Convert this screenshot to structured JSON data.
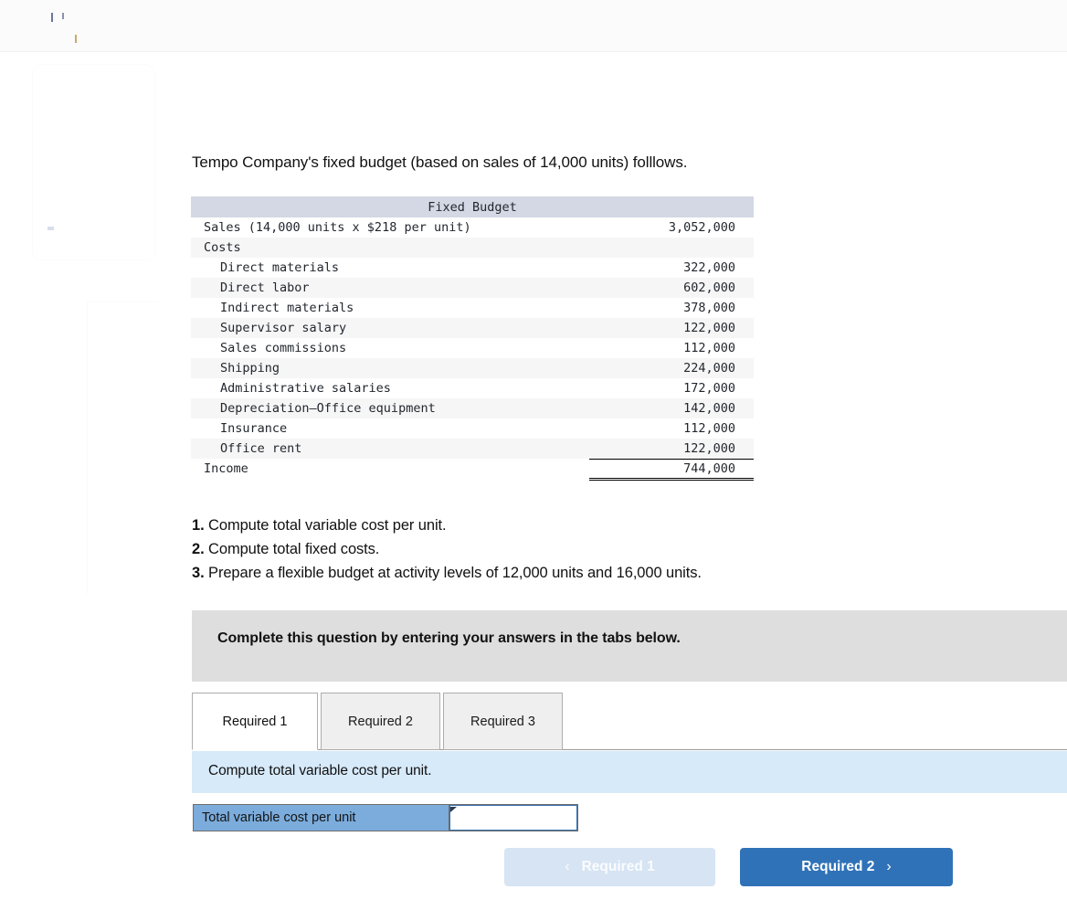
{
  "intro": "Tempo Company's fixed budget (based on sales of 14,000 units) folllows.",
  "budget_table": {
    "header": "Fixed Budget",
    "rows": [
      {
        "label": "Sales (14,000 units x $218 per unit)",
        "indent": 1,
        "amount": "3,052,000"
      },
      {
        "label": "Costs",
        "indent": 1,
        "amount": ""
      },
      {
        "label": "Direct materials",
        "indent": 2,
        "amount": "322,000"
      },
      {
        "label": "Direct labor",
        "indent": 2,
        "amount": "602,000"
      },
      {
        "label": "Indirect materials",
        "indent": 2,
        "amount": "378,000"
      },
      {
        "label": "Supervisor salary",
        "indent": 2,
        "amount": "122,000"
      },
      {
        "label": "Sales commissions",
        "indent": 2,
        "amount": "112,000"
      },
      {
        "label": "Shipping",
        "indent": 2,
        "amount": "224,000"
      },
      {
        "label": "Administrative salaries",
        "indent": 2,
        "amount": "172,000"
      },
      {
        "label": "Depreciation—Office equipment",
        "indent": 2,
        "amount": "142,000"
      },
      {
        "label": "Insurance",
        "indent": 2,
        "amount": "112,000"
      },
      {
        "label": "Office rent",
        "indent": 2,
        "amount": "122,000"
      },
      {
        "label": "Income",
        "indent": 1,
        "amount": "744,000"
      }
    ]
  },
  "requirements": [
    {
      "num": "1.",
      "text": "Compute total variable cost per unit."
    },
    {
      "num": "2.",
      "text": "Compute total fixed costs."
    },
    {
      "num": "3.",
      "text": "Prepare a flexible budget at activity levels of 12,000 units and 16,000 units."
    }
  ],
  "complete_banner": {
    "text": "Complete this question by entering your answers in the tabs below."
  },
  "tabs": [
    {
      "label": "Required 1",
      "active": true
    },
    {
      "label": "Required 2",
      "active": false
    },
    {
      "label": "Required 3",
      "active": false
    }
  ],
  "prompt": "Compute total variable cost per unit.",
  "answer_row": {
    "label": "Total variable cost per unit",
    "value": "",
    "placeholder": ""
  },
  "nav": {
    "prev_label": "Required 1",
    "prev_chevron": "‹",
    "next_label": "Required 2",
    "next_chevron": "›"
  },
  "colors": {
    "table_header_bg": "#d3d8e4",
    "banner_gray": "#dedede",
    "prompt_blue": "#d7eafa",
    "answer_label_blue": "#7bacdc",
    "next_button_blue": "#3072b8",
    "prev_button_blue": "#d6e4f3"
  }
}
